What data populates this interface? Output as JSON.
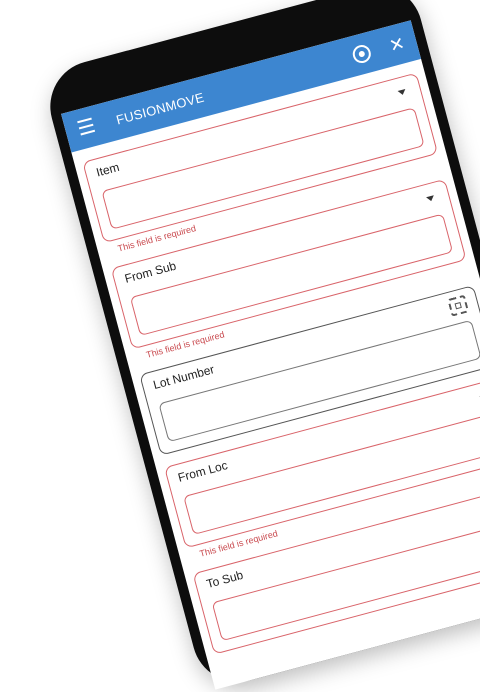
{
  "app": {
    "title": "FUSIONMOVE",
    "icons": {
      "menu": "menu-icon",
      "settings": "gear-icon",
      "close": "close-icon"
    }
  },
  "colors": {
    "appbar": "#3d86d0",
    "error": "#c94a4f",
    "frame": "#0d0d0d"
  },
  "fields": {
    "item": {
      "label": "Item",
      "error": "This field is required"
    },
    "from_sub": {
      "label": "From Sub",
      "error": "This field is required"
    },
    "lot_number": {
      "label": "Lot Number"
    },
    "from_loc": {
      "label": "From Loc",
      "error": "This field is required"
    },
    "to_sub": {
      "label": "To Sub"
    }
  }
}
